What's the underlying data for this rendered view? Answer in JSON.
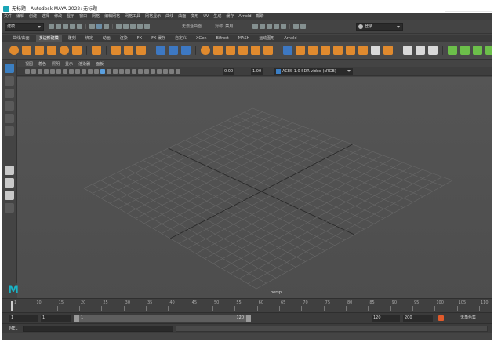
{
  "window": {
    "title": "无标题 - Autodesk MAYA 2022: 无标题"
  },
  "menubar": {
    "items": [
      "文件",
      "编辑",
      "创建",
      "选择",
      "修改",
      "显示",
      "窗口",
      "网格",
      "编辑网格",
      "网格工具",
      "网格显示",
      "曲线",
      "曲面",
      "变形",
      "UV",
      "生成",
      "缓存",
      "Arnold",
      "帮助"
    ]
  },
  "statusline": {
    "mode": "建模",
    "no_live_surface": "无激活曲面",
    "symmetry": "对称: 禁用",
    "login": "登录"
  },
  "shelf": {
    "tabs": [
      "曲线/曲面",
      "多边形建模",
      "雕刻",
      "绑定",
      "动画",
      "渲染",
      "FX",
      "FX 缓存",
      "自定义",
      "XGen",
      "Bifrost",
      "MASH",
      "运动图形",
      "Arnold"
    ],
    "active_tab": "多边形建模"
  },
  "viewport": {
    "menu": [
      "视图",
      "着色",
      "照明",
      "显示",
      "渲染器",
      "面板"
    ],
    "exposure": "0.00",
    "gamma": "1.00",
    "color_space": "ACES 1.0 SDR-video (sRGB)",
    "camera": "persp"
  },
  "timeline": {
    "ticks": [
      "1",
      "10",
      "15",
      "20",
      "25",
      "30",
      "35",
      "40",
      "45",
      "50",
      "55",
      "60",
      "65",
      "70",
      "75",
      "80",
      "85",
      "90",
      "95",
      "100",
      "105",
      "110"
    ],
    "current_frame": "1"
  },
  "range": {
    "start": "1",
    "anim_start": "1",
    "slider_start": "1",
    "slider_end": "120",
    "end": "120",
    "anim_end": "200",
    "character_set": "无角色集"
  },
  "command_line": {
    "label": "MEL"
  },
  "colors": {
    "maya_teal": "#19b3c6",
    "shelf_orange": "#e08a2e",
    "active_blue": "#3c7fc1"
  }
}
